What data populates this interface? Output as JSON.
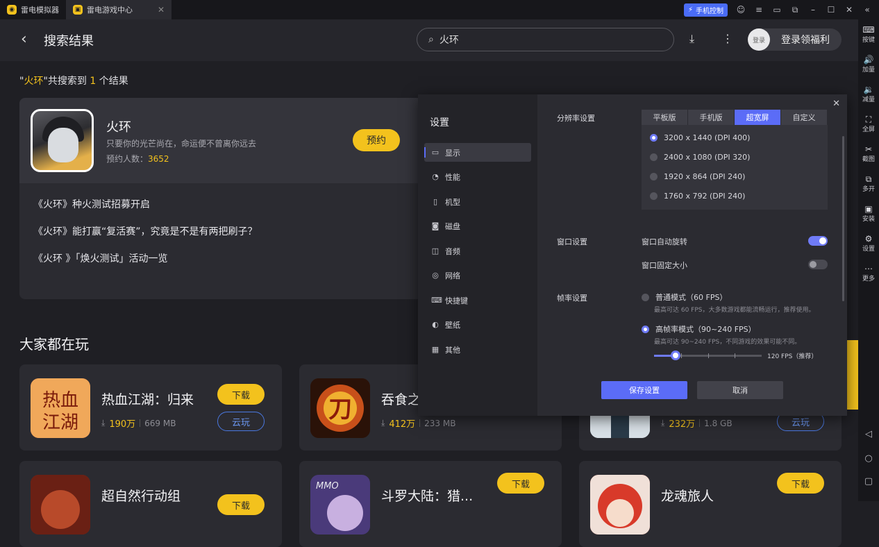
{
  "titlebar": {
    "tabs": [
      {
        "label": "雷电模拟器",
        "icon": "emulator-logo-icon"
      },
      {
        "label": "雷电游戏中心",
        "icon": "game-center-logo-icon"
      }
    ],
    "phone_control": "手机控制"
  },
  "sidebar": {
    "items": [
      {
        "label": "按键",
        "icon": "keyboard-icon",
        "glyph": "⌨"
      },
      {
        "label": "加量",
        "icon": "volume-up-icon",
        "glyph": "🔊"
      },
      {
        "label": "减量",
        "icon": "volume-down-icon",
        "glyph": "🔉"
      },
      {
        "label": "全屏",
        "icon": "fullscreen-icon",
        "glyph": "⛶"
      },
      {
        "label": "截图",
        "icon": "scissors-icon",
        "glyph": "✂"
      },
      {
        "label": "多开",
        "icon": "multi-instance-icon",
        "glyph": "⧉"
      },
      {
        "label": "安装",
        "icon": "install-icon",
        "glyph": "▣"
      },
      {
        "label": "设置",
        "icon": "gear-icon",
        "glyph": "⚙"
      },
      {
        "label": "更多",
        "icon": "more-icon",
        "glyph": "⋯"
      }
    ]
  },
  "header": {
    "title": "搜索结果",
    "search_value": "火环"
  },
  "login": {
    "avatar_label": "登录",
    "label": "登录领福利"
  },
  "result_summary": {
    "quote_open": "\"",
    "keyword": "火环",
    "middle": "\"共搜索到 ",
    "count": "1",
    "suffix": " 个结果"
  },
  "featured": {
    "name": "火环",
    "desc": "只要你的光芒尚在，命运便不曾离你远去",
    "count_label": "预约人数：",
    "count": "3652",
    "button": "预约",
    "news": [
      "《火环》种火测试招募开启",
      "《火环》能打赢“复活赛”，究竟是不是有两把刷子？",
      "《火环 》「焕火测试」活动一览"
    ]
  },
  "popular": {
    "title": "大家都在玩",
    "apps": [
      {
        "name": "热血江湖：归来",
        "downloads": "190万",
        "size": "669 MB",
        "download": "下载",
        "cloud": "云玩"
      },
      {
        "name": "吞食之",
        "downloads": "412万",
        "size": "233 MB",
        "download": "",
        "cloud": ""
      },
      {
        "name": "",
        "downloads": "232万",
        "size": "1.8 GB",
        "download": "",
        "cloud": "云玩"
      },
      {
        "name": "超自然行动组",
        "downloads": "",
        "size": "",
        "download": "下载",
        "cloud": ""
      },
      {
        "name": "斗罗大陆：猎...",
        "downloads": "",
        "size": "",
        "download": "下载",
        "cloud": ""
      },
      {
        "name": "龙魂旅人",
        "downloads": "",
        "size": "",
        "download": "下载",
        "cloud": ""
      }
    ]
  },
  "settings": {
    "title": "设置",
    "menu": [
      {
        "label": "显示",
        "icon": "monitor-icon",
        "glyph": "▭"
      },
      {
        "label": "性能",
        "icon": "performance-icon",
        "glyph": "◔"
      },
      {
        "label": "机型",
        "icon": "device-model-icon",
        "glyph": "▯"
      },
      {
        "label": "磁盘",
        "icon": "disk-icon",
        "glyph": "◙"
      },
      {
        "label": "音频",
        "icon": "audio-icon",
        "glyph": "◫"
      },
      {
        "label": "网络",
        "icon": "network-icon",
        "glyph": "◎"
      },
      {
        "label": "快捷键",
        "icon": "shortcut-icon",
        "glyph": "⌨"
      },
      {
        "label": "壁纸",
        "icon": "wallpaper-icon",
        "glyph": "◐"
      },
      {
        "label": "其他",
        "icon": "other-icon",
        "glyph": "▦"
      }
    ],
    "resolution_label": "分辨率设置",
    "res_tabs": [
      "平板版",
      "手机版",
      "超宽屏",
      "自定义"
    ],
    "res_tab_selected": "超宽屏",
    "resolutions": [
      "3200 x 1440  (DPI 400)",
      "2400 x 1080  (DPI 320)",
      "1920 x 864  (DPI 240)",
      "1760 x 792  (DPI 240)"
    ],
    "resolution_selected": "3200 x 1440  (DPI 400)",
    "window_label": "窗口设置",
    "auto_rotate": "窗口自动旋转",
    "auto_rotate_on": true,
    "fixed_size": "窗口固定大小",
    "fixed_size_on": false,
    "fps_label": "帧率设置",
    "normal_mode": "普通模式（60 FPS）",
    "normal_hint": "最高可达 60 FPS，大多数游戏都能流畅运行，推荐使用。",
    "high_mode": "高帧率模式（90~240 FPS）",
    "high_hint": "最高可达 90~240 FPS，不同游戏的效果可能不同。",
    "fps_selected": "high",
    "fps_value": "120 FPS（推荐）",
    "fps_level": 0.2,
    "save": "保存设置",
    "cancel": "取消"
  },
  "colors": {
    "accent": "#f3c21d",
    "primary_blue": "#5b6cf7",
    "background": "#1f1f24"
  }
}
